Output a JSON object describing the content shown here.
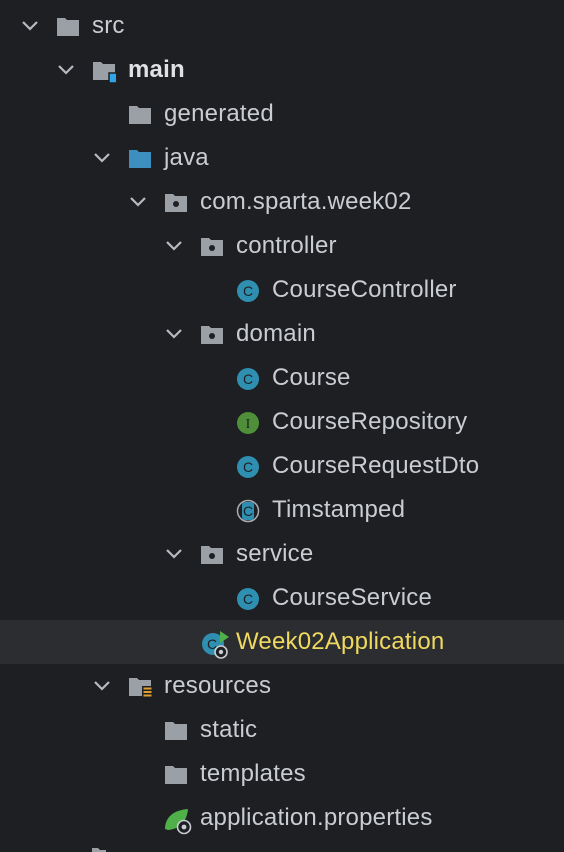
{
  "tree": {
    "src": "src",
    "main": "main",
    "generated": "generated",
    "java": "java",
    "package": "com.sparta.week02",
    "controller": "controller",
    "course_controller": "CourseController",
    "domain": "domain",
    "course": "Course",
    "course_repository": "CourseRepository",
    "course_request_dto": "CourseRequestDto",
    "timstamped": "Timstamped",
    "service": "service",
    "course_service": "CourseService",
    "application": "Week02Application",
    "resources": "resources",
    "static": "static",
    "templates": "templates",
    "application_properties": "application.properties"
  },
  "colors": {
    "background": "#1e1f22",
    "selected_row": "#2b2d30",
    "text": "#c9ccd1",
    "highlight_text": "#f0d95f",
    "folder": "#9aa0a6",
    "source_folder": "#3d8fbf",
    "class_icon": "#2f8fb0",
    "interface_icon": "#4f8f3a"
  },
  "icons": {
    "folder": "folder-icon",
    "source_root": "source-root-folder-icon",
    "package": "package-icon",
    "class": "class-icon",
    "interface": "interface-icon",
    "abstract_class": "abstract-class-icon",
    "spring_boot": "spring-boot-app-icon",
    "resources": "resources-folder-icon",
    "properties": "spring-properties-icon"
  }
}
